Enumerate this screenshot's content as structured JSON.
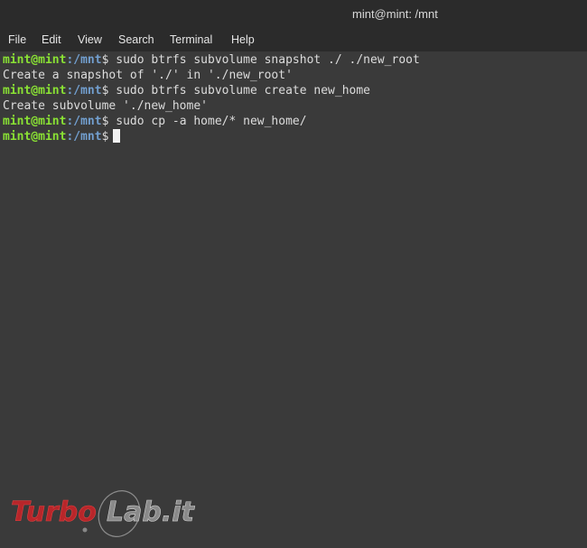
{
  "window": {
    "title": "mint@mint: /mnt"
  },
  "menubar": {
    "items": [
      {
        "label": "File"
      },
      {
        "label": "Edit"
      },
      {
        "label": "View"
      },
      {
        "label": "Search"
      },
      {
        "label": "Terminal"
      },
      {
        "label": "Help"
      }
    ]
  },
  "terminal": {
    "prompt": {
      "user": "mint@mint",
      "path": ":/mnt",
      "symbol": "$"
    },
    "lines": [
      {
        "type": "command",
        "text": " sudo btrfs subvolume snapshot ./ ./new_root"
      },
      {
        "type": "output",
        "text": "Create a snapshot of './' in './new_root'"
      },
      {
        "type": "command",
        "text": " sudo btrfs subvolume create new_home"
      },
      {
        "type": "output",
        "text": "Create subvolume './new_home'"
      },
      {
        "type": "command",
        "text": " sudo cp -a home/* new_home/"
      },
      {
        "type": "command",
        "text": ""
      }
    ]
  },
  "watermark": {
    "part1": "Turbo",
    "part2": "Lab.it"
  },
  "colors": {
    "prompt_user": "#8ae234",
    "prompt_path": "#729fcf",
    "background": "#3a3a3a",
    "text": "#dcdcdc"
  }
}
